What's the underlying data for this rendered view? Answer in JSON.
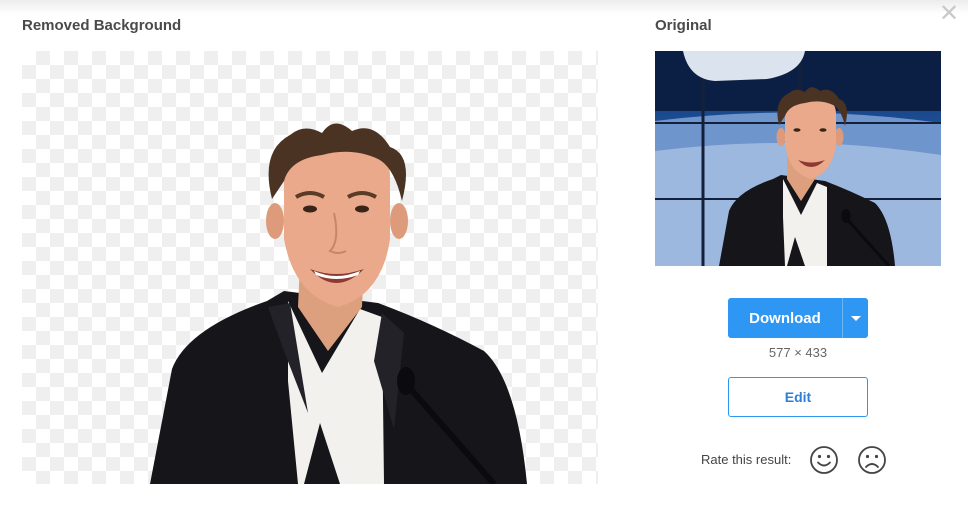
{
  "dialog": {
    "close_symbol": "✕",
    "removed_title": "Removed Background",
    "original_title": "Original"
  },
  "actions": {
    "download_label": "Download",
    "dimensions": "577 × 433",
    "edit_label": "Edit"
  },
  "rating": {
    "label": "Rate this result:",
    "icons": [
      "smiley-face-icon",
      "frowning-face-icon"
    ]
  },
  "images": {
    "result_alt": "Cutout of man in black suit jacket and white shirt on transparent background",
    "original_alt": "Man in black suit jacket at microphone in front of Earth view backdrop"
  },
  "colors": {
    "accent": "#2e96f3",
    "text": "#4a4a4a",
    "checker": "#efefef"
  }
}
